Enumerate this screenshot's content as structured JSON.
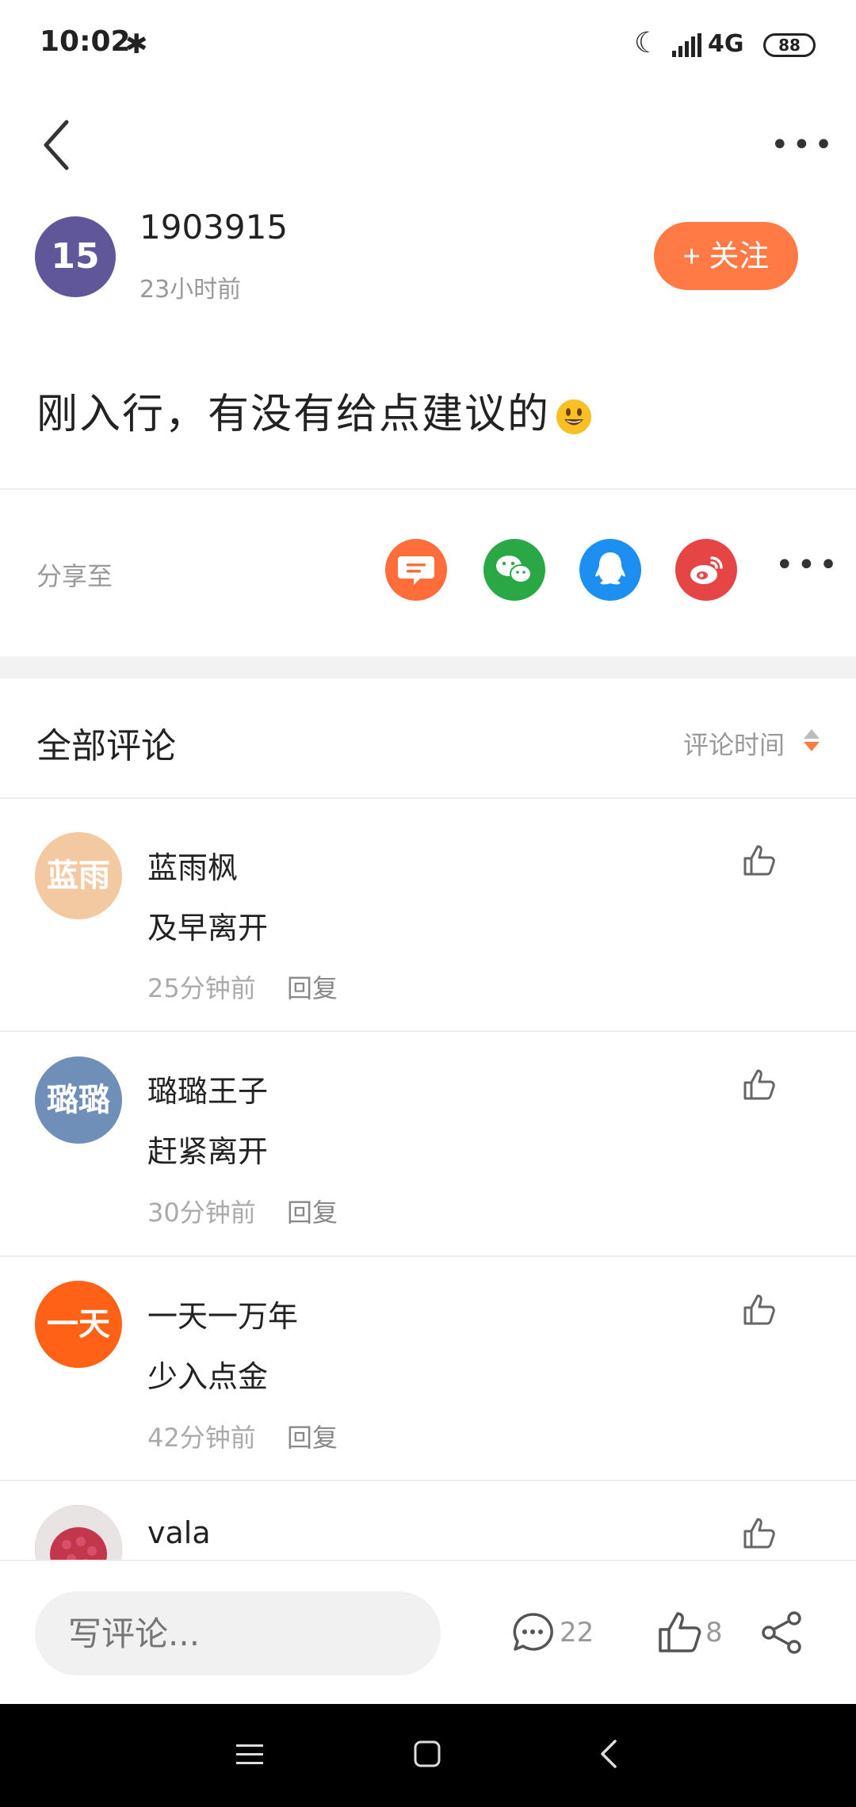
{
  "status_bar": {
    "time": "10:02",
    "network": "4G",
    "battery": "88"
  },
  "author": {
    "avatar_text": "15",
    "name": "1903915",
    "time": "23小时前",
    "follow_label": "+ 关注"
  },
  "post": {
    "text": "刚入行，有没有给点建议的"
  },
  "share": {
    "label": "分享至",
    "icons": [
      "message-icon",
      "wechat-icon",
      "qq-icon",
      "weibo-icon"
    ]
  },
  "comments_header": {
    "title": "全部评论",
    "sort_label": "评论时间"
  },
  "comments": [
    {
      "avatar_text": "蓝雨",
      "avatar_color": "#f3c9a2",
      "name": "蓝雨枫",
      "text": "及早离开",
      "time": "25分钟前",
      "reply": "回复"
    },
    {
      "avatar_text": "璐璐",
      "avatar_color": "#6f8fb8",
      "name": "璐璐王子",
      "text": "赶紧离开",
      "time": "30分钟前",
      "reply": "回复"
    },
    {
      "avatar_text": "一天",
      "avatar_color": "#ff6216",
      "name": "一天一万年",
      "text": "少入点金",
      "time": "42分钟前",
      "reply": "回复"
    },
    {
      "avatar_text": "",
      "avatar_color": "#c94a5c",
      "name": "vala",
      "text": "",
      "time": "",
      "reply": ""
    }
  ],
  "bottom_bar": {
    "input_placeholder": "写评论...",
    "comment_count": "22",
    "like_count": "8"
  },
  "colors": {
    "accent": "#ff7a45",
    "message": "#ff6d3a",
    "wechat": "#2aa845",
    "qq": "#1d8ff0",
    "weibo": "#e64545"
  }
}
